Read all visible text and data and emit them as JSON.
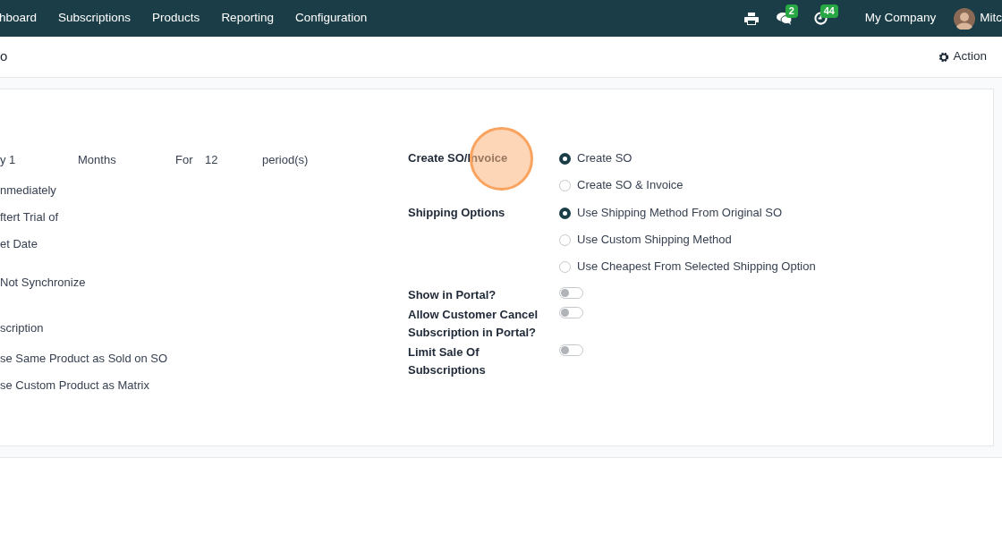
{
  "navbar": {
    "menu": [
      {
        "label": "hboard"
      },
      {
        "label": "Subscriptions"
      },
      {
        "label": "Products"
      },
      {
        "label": "Reporting"
      },
      {
        "label": "Configuration"
      }
    ],
    "messages_count": "2",
    "activities_count": "44",
    "company": "My Company",
    "user": "Mitc"
  },
  "control_panel": {
    "breadcrumb": "o",
    "action": "Action"
  },
  "left_column": {
    "recurrence": {
      "interval": "y 1",
      "unit": "Months",
      "for_label": "For",
      "count": "12",
      "suffix": "period(s)"
    },
    "lines": [
      "nmediately",
      "ftert Trial of",
      "et Date",
      "Not Synchronize",
      "scription",
      "se Same Product as Sold on SO",
      "se Custom Product as Matrix"
    ]
  },
  "settings": [
    {
      "kind": "radio",
      "label": "Create SO/Invoice",
      "options": [
        {
          "label": "Create SO",
          "selected": true
        },
        {
          "label": "Create SO & Invoice",
          "selected": false
        }
      ]
    },
    {
      "kind": "radio",
      "label": "Shipping Options",
      "options": [
        {
          "label": "Use Shipping Method From Original SO",
          "selected": true
        },
        {
          "label": "Use Custom Shipping Method",
          "selected": false
        },
        {
          "label": "Use Cheapest From Selected Shipping Option",
          "selected": false
        }
      ]
    },
    {
      "kind": "toggle",
      "label": "Show in Portal?",
      "on": false
    },
    {
      "kind": "toggle",
      "label": "Allow Customer Cancel Subscription in Portal?",
      "on": false
    },
    {
      "kind": "toggle",
      "label": "Limit Sale Of Subscriptions",
      "on": false
    }
  ]
}
